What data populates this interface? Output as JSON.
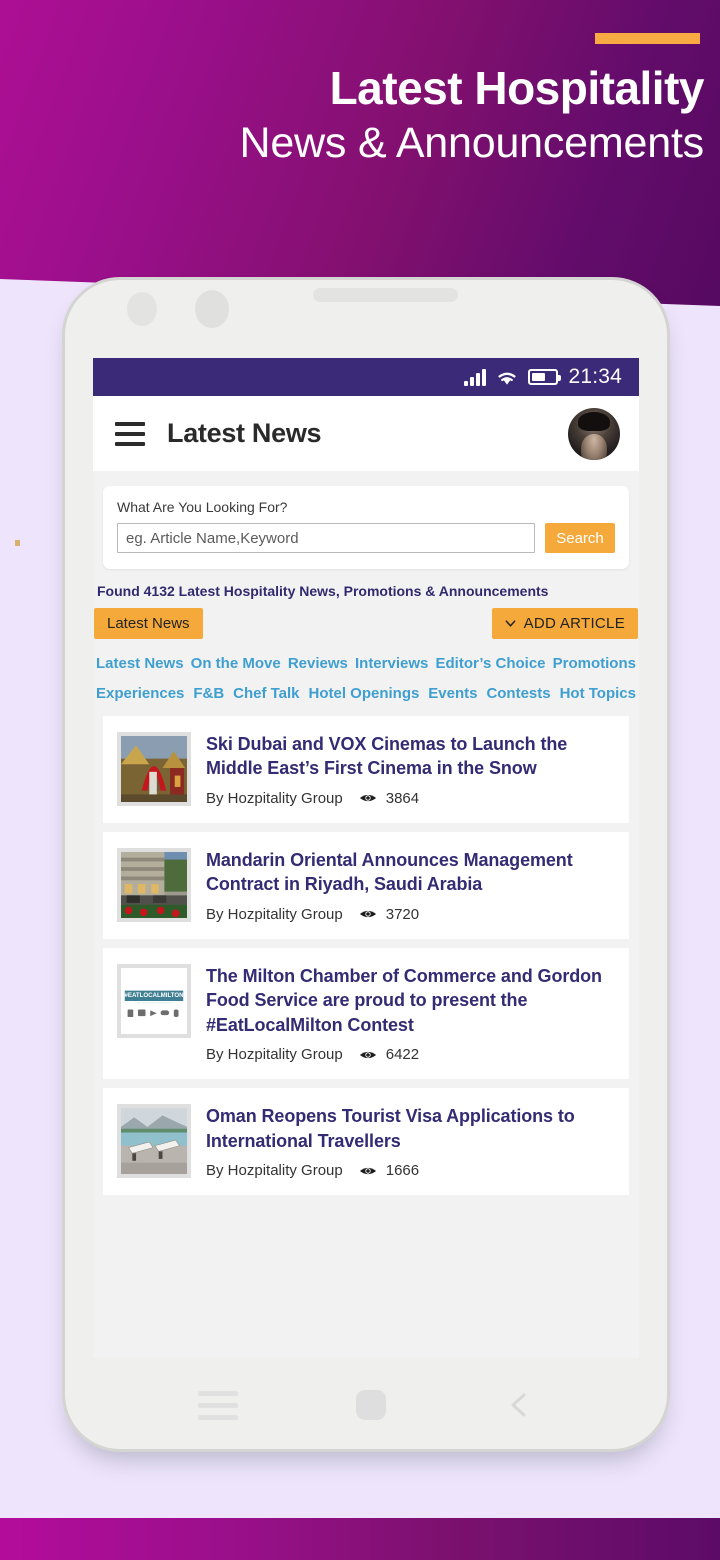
{
  "banner": {
    "title_line1": "Latest Hospitality",
    "title_line2": "News & Announcements",
    "accent_color": "#f9ab43",
    "gradient_from": "#ad0f94",
    "gradient_to": "#560a60"
  },
  "statusbar": {
    "time": "21:34",
    "signal_icon": "signal-bars-icon",
    "wifi_icon": "wifi-icon",
    "battery_icon": "battery-icon",
    "battery_level": "58%",
    "background_color": "#3b2a77"
  },
  "appbar": {
    "menu_icon": "hamburger-menu-icon",
    "title": "Latest News",
    "avatar_icon": "user-avatar"
  },
  "search": {
    "label": "What Are You Looking For?",
    "placeholder": "eg. Article Name,Keyword",
    "value": "",
    "button_label": "Search",
    "button_color": "#f5a93b"
  },
  "results": {
    "found_text": "Found 4132 Latest Hospitality News, Promotions & Announcements",
    "active_chip": "Latest News",
    "add_article_label": "ADD ARTICLE",
    "add_article_icon": "chevron-down-icon"
  },
  "categories": {
    "row1": [
      "Latest News",
      "On the Move",
      "Reviews",
      "Interviews",
      "Editor’s Choice",
      "Promotions"
    ],
    "row2": [
      "Experiences",
      "F&B",
      "Chef Talk",
      "Hotel Openings",
      "Events",
      "Contests",
      "Hot Topics"
    ],
    "link_color": "#3e9fd0"
  },
  "articles": [
    {
      "title": "Ski Dubai and VOX Cinemas to Launch the Middle East’s First Cinema in the Snow",
      "author": "By Hozpitality Group",
      "views": "3864",
      "views_icon": "eye-icon",
      "thumb": "ski-dubai-thumbnail"
    },
    {
      "title": "Mandarin Oriental Announces Management Contract in Riyadh, Saudi Arabia",
      "author": "By Hozpitality Group",
      "views": "3720",
      "views_icon": "eye-icon",
      "thumb": "mandarin-oriental-thumbnail"
    },
    {
      "title": "The Milton Chamber of Commerce and Gordon Food Service are proud to present the #EatLocalMilton Contest",
      "author": "By Hozpitality Group",
      "views": "6422",
      "views_icon": "eye-icon",
      "thumb": "eatlocalmilton-thumbnail"
    },
    {
      "title": "Oman Reopens Tourist Visa Applications to International Travellers",
      "author": "By Hozpitality Group",
      "views": "1666",
      "views_icon": "eye-icon",
      "thumb": "oman-pool-thumbnail"
    }
  ],
  "navbar": {
    "recent_icon": "recent-apps-icon",
    "home_icon": "home-button-icon",
    "back_icon": "back-chevron-icon"
  }
}
